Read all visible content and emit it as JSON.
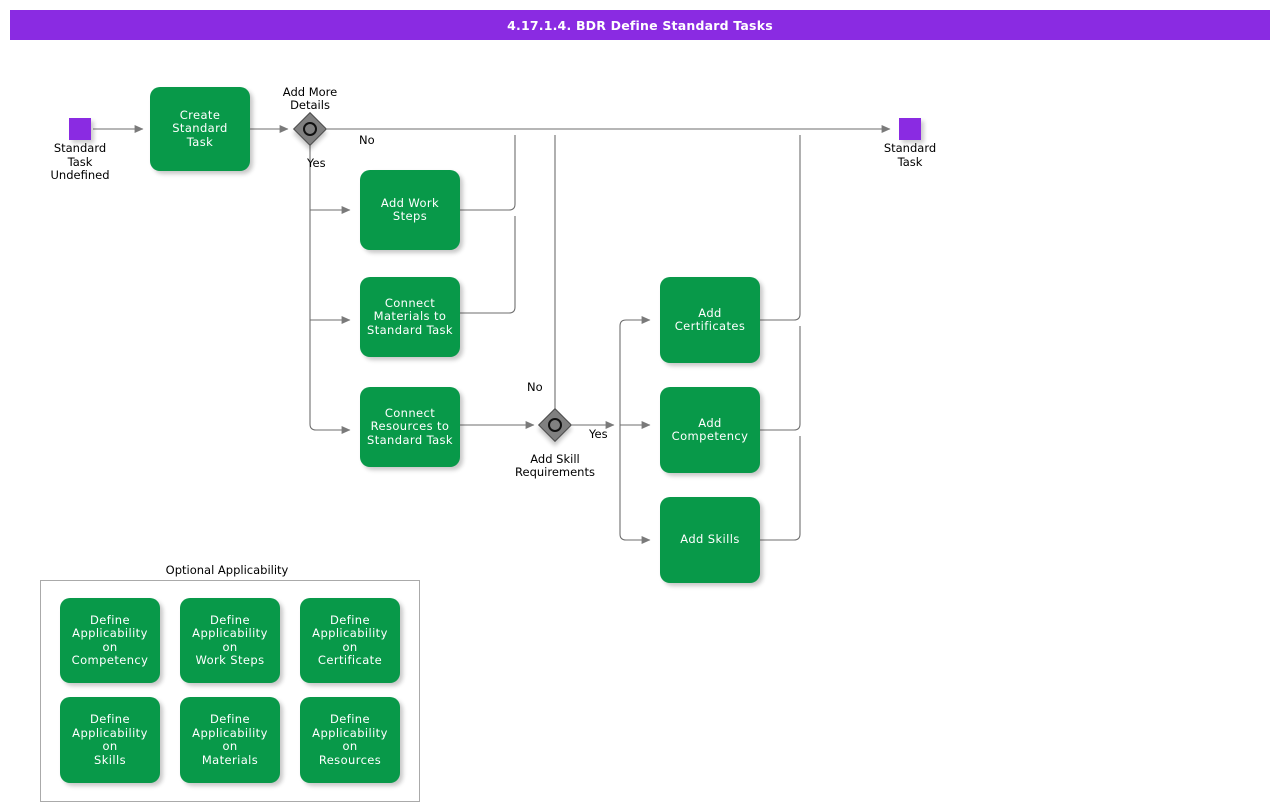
{
  "header": {
    "title": "4.17.1.4. BDR Define Standard Tasks",
    "banner_color": "#8A2BE2"
  },
  "palette": {
    "task_green": "#089949",
    "event_purple": "#8A2BE2",
    "gateway_gray": "#808080",
    "connector_gray": "#666666",
    "group_border": "#aaaaaa",
    "text_on_task": "#ffffff",
    "text_default": "#000000"
  },
  "events": [
    {
      "id": "start",
      "label": "Standard\nTask\nUndefined",
      "type": "start-event"
    },
    {
      "id": "end",
      "label": "Standard\nTask",
      "type": "end-event"
    }
  ],
  "gateways": [
    {
      "id": "gw1",
      "label": "Add More\nDetails",
      "type": "event-gateway"
    },
    {
      "id": "gw2",
      "label": "Add Skill\nRequirements",
      "type": "event-gateway"
    }
  ],
  "edge_labels": {
    "gw1_no": "No",
    "gw1_yes": "Yes",
    "gw2_no": "No",
    "gw2_yes": "Yes"
  },
  "tasks": [
    {
      "id": "create_standard_task",
      "label": "Create Standard\nTask"
    },
    {
      "id": "add_work_steps",
      "label": "Add Work Steps"
    },
    {
      "id": "connect_materials",
      "label": "Connect\nMaterials to\nStandard Task"
    },
    {
      "id": "connect_resources",
      "label": "Connect\nResources to\nStandard Task"
    },
    {
      "id": "add_certificates",
      "label": "Add Certificates"
    },
    {
      "id": "add_competency",
      "label": "Add\nCompetency"
    },
    {
      "id": "add_skills",
      "label": "Add Skills"
    }
  ],
  "group": {
    "title": "Optional Applicability",
    "tasks": [
      {
        "id": "app_competency",
        "label": "Define\nApplicability on\nCompetency"
      },
      {
        "id": "app_work_steps",
        "label": "Define\nApplicability on\nWork Steps"
      },
      {
        "id": "app_certificate",
        "label": "Define\nApplicability on\nCertificate"
      },
      {
        "id": "app_skills",
        "label": "Define\nApplicability on\nSkills"
      },
      {
        "id": "app_materials",
        "label": "Define\nApplicability on\nMaterials"
      },
      {
        "id": "app_resources",
        "label": "Define\nApplicability on\nResources"
      }
    ]
  }
}
